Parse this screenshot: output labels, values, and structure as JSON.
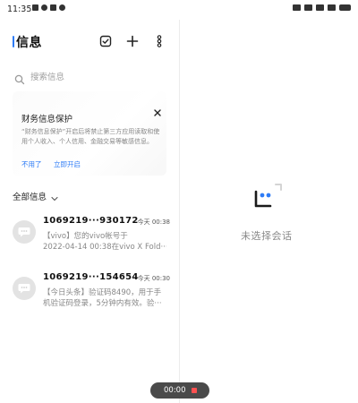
{
  "status_bar": {
    "time": "11:35"
  },
  "header": {
    "title": "信息",
    "icons": [
      "checkbox-select-icon",
      "plus-icon",
      "more-vertical-icon"
    ]
  },
  "search": {
    "placeholder": "搜索信息"
  },
  "finance_card": {
    "title": "财务信息保护",
    "body": "“财务信息保护”开启后将禁止第三方应用读取和使用个人收入、个人信用、金融交易等敏感信息。",
    "decline_label": "不用了",
    "enable_label": "立即开启"
  },
  "filter": {
    "label": "全部信息"
  },
  "messages": [
    {
      "sender": "1069219···930172",
      "time": "今天 00:38",
      "preview_line1": "【vivo】您的vivo帐号于",
      "preview_line2": "2022-04-14 00:38在vivo X Fold···"
    },
    {
      "sender": "1069219···154654",
      "time": "今天 00:30",
      "preview_line1": "【今日头条】验证码8490，用于手",
      "preview_line2": "机验证码登录，5分钟内有效。验···"
    }
  ],
  "detail_pane": {
    "empty_text": "未选择会话"
  },
  "recorder": {
    "time": "00:00"
  },
  "colors": {
    "accent": "#2e7cf6",
    "recorder_bg": "#4a4a4a",
    "recorder_stop": "#ff5151"
  }
}
